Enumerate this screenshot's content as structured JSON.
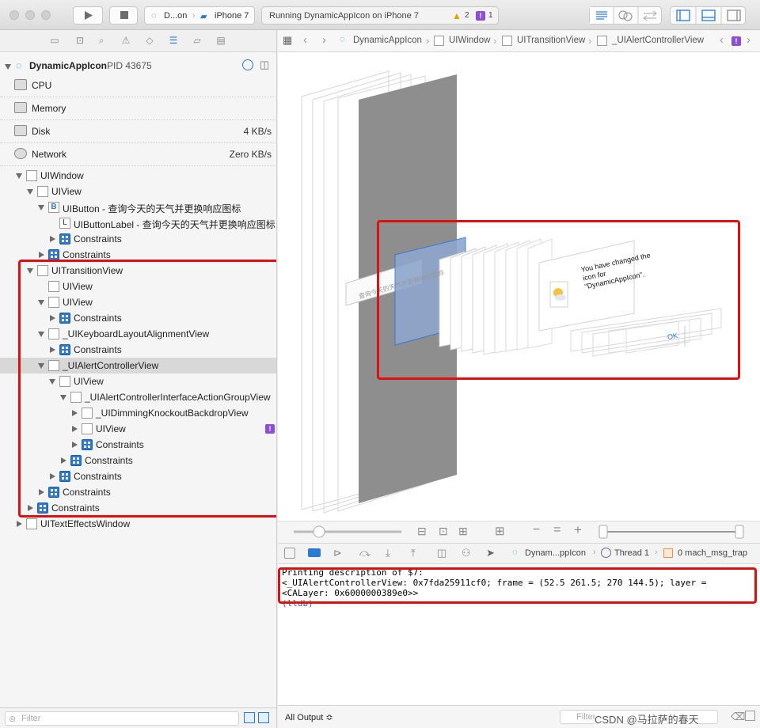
{
  "toolbar": {
    "scheme_app": "D...on",
    "scheme_device": "iPhone 7",
    "activity_status": "Running DynamicAppIcon on iPhone 7",
    "warning_count": "2",
    "issue_count": "1"
  },
  "process": {
    "name": "DynamicAppIcon",
    "pid": "PID 43675"
  },
  "gauges": [
    {
      "label": "CPU",
      "value": ""
    },
    {
      "label": "Memory",
      "value": ""
    },
    {
      "label": "Disk",
      "value": "4 KB/s"
    },
    {
      "label": "Network",
      "value": "Zero KB/s"
    }
  ],
  "tree": [
    {
      "label": "UIWindow"
    },
    {
      "label": "UIView"
    },
    {
      "label": "UIButton - 查询今天的天气并更换响应图标"
    },
    {
      "label": "UIButtonLabel - 查询今天的天气并更换响应图标"
    },
    {
      "label": "Constraints"
    },
    {
      "label": "Constraints"
    },
    {
      "label": "UITransitionView"
    },
    {
      "label": "UIView"
    },
    {
      "label": "UIView"
    },
    {
      "label": "Constraints"
    },
    {
      "label": "_UIKeyboardLayoutAlignmentView"
    },
    {
      "label": "Constraints"
    },
    {
      "label": "_UIAlertControllerView"
    },
    {
      "label": "UIView"
    },
    {
      "label": "_UIAlertControllerInterfaceActionGroupView"
    },
    {
      "label": "_UIDimmingKnockoutBackdropView"
    },
    {
      "label": "UIView"
    },
    {
      "label": "Constraints"
    },
    {
      "label": "Constraints"
    },
    {
      "label": "Constraints"
    },
    {
      "label": "Constraints"
    },
    {
      "label": "Constraints"
    },
    {
      "label": "UITextEffectsWindow"
    }
  ],
  "filter_placeholder": "Filter",
  "jumpbar": {
    "crumbs": [
      "DynamicAppIcon",
      "UIWindow",
      "UITransitionView",
      "_UIAlertControllerView"
    ],
    "badge": "!"
  },
  "alert": {
    "message_line1": "You have changed the",
    "message_line2": "icon for",
    "message_line3": "\"DynamicAppIcon\".",
    "ok": "OK",
    "button_text": "查询今天的天气并更换响应图标"
  },
  "debug_bar": {
    "process": "Dynam...ppIcon",
    "thread": "Thread 1",
    "frame": "0 mach_msg_trap"
  },
  "console": {
    "lines": [
      "Printing description of $7:",
      "<_UIAlertControllerView: 0x7fda25911cf0; frame = (52.5 261.5; 270 144.5); layer =",
      "<CALayer: 0x6000000389e0>>",
      "(lldb)"
    ],
    "output_selector": "All Output ≎",
    "filter_placeholder": "Filter"
  },
  "watermark": "CSDN @马拉萨的春天",
  "colors": {
    "highlight_red": "#e01010",
    "accent_blue": "#2a79d4",
    "issue_purple": "#8c4fd4"
  }
}
